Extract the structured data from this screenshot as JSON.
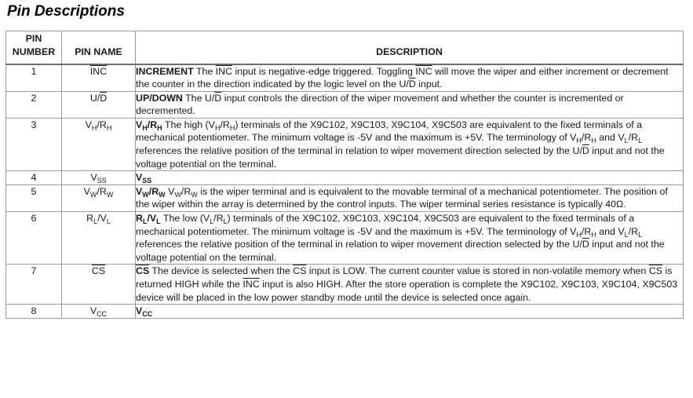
{
  "page": {
    "title": "Pin Descriptions"
  },
  "table": {
    "headers": {
      "pin_number_1": "PIN",
      "pin_number_2": "NUMBER",
      "pin_name": "PIN NAME",
      "description": "DESCRIPTION"
    },
    "rows": [
      {
        "number": "1",
        "name": [
          {
            "t": "INC",
            "o": true
          }
        ],
        "desc": [
          {
            "t": "INCREMENT",
            "b": true
          },
          {
            "t": " The "
          },
          {
            "t": "INC",
            "o": true
          },
          {
            "t": " input is negative-edge triggered. Toggling "
          },
          {
            "t": "INC",
            "o": true
          },
          {
            "t": " will move the wiper and either increment or decrement the counter in the direction indicated by the logic level on the U/"
          },
          {
            "t": "D",
            "o": true
          },
          {
            "t": " input."
          }
        ]
      },
      {
        "number": "2",
        "name": [
          {
            "t": "U/"
          },
          {
            "t": "D",
            "o": true
          }
        ],
        "desc": [
          {
            "t": "UP/DOWN",
            "b": true
          },
          {
            "t": " The U/"
          },
          {
            "t": "D",
            "o": true
          },
          {
            "t": " input controls the direction of the wiper movement and whether the counter is incremented or decremented."
          }
        ]
      },
      {
        "number": "3",
        "name": [
          {
            "t": "V"
          },
          {
            "t": "H",
            "s": true
          },
          {
            "t": "/R"
          },
          {
            "t": "H",
            "s": true
          }
        ],
        "desc": [
          {
            "t": "V",
            "b": true
          },
          {
            "t": "H",
            "s": true,
            "b": true
          },
          {
            "t": "/R",
            "b": true
          },
          {
            "t": "H",
            "s": true,
            "b": true
          },
          {
            "t": " The high (V"
          },
          {
            "t": "H",
            "s": true
          },
          {
            "t": "/R"
          },
          {
            "t": "H",
            "s": true
          },
          {
            "t": ") terminals of the X9C102, X9C103, X9C104, X9C503 are equivalent to the fixed terminals of a mechanical potentiometer. The minimum voltage is -5V and the maximum is +5V. The terminology of V"
          },
          {
            "t": "H",
            "s": true
          },
          {
            "t": "/R"
          },
          {
            "t": "H",
            "s": true
          },
          {
            "t": " and V"
          },
          {
            "t": "L",
            "s": true
          },
          {
            "t": "/R"
          },
          {
            "t": "L",
            "s": true
          },
          {
            "t": " references the relative position of the terminal in relation to wiper movement direction selected by the U/"
          },
          {
            "t": "D",
            "o": true
          },
          {
            "t": " input and not the voltage potential on the terminal."
          }
        ]
      },
      {
        "number": "4",
        "name": [
          {
            "t": "V"
          },
          {
            "t": "SS",
            "s": true
          }
        ],
        "desc": [
          {
            "t": "V",
            "b": true
          },
          {
            "t": "SS",
            "s": true,
            "b": true
          }
        ]
      },
      {
        "number": "5",
        "name": [
          {
            "t": "V"
          },
          {
            "t": "W",
            "s": true
          },
          {
            "t": "/R"
          },
          {
            "t": "W",
            "s": true
          }
        ],
        "desc": [
          {
            "t": "V",
            "b": true
          },
          {
            "t": "W",
            "s": true,
            "b": true
          },
          {
            "t": "/R",
            "b": true
          },
          {
            "t": "W",
            "s": true,
            "b": true
          },
          {
            "t": " V"
          },
          {
            "t": "W",
            "s": true
          },
          {
            "t": "/R"
          },
          {
            "t": "W",
            "s": true
          },
          {
            "t": " is the wiper terminal and is equivalent to the movable terminal of a mechanical potentiometer. The position of the wiper within the array is determined by the control inputs. The wiper terminal series resistance is typically 40Ω."
          }
        ]
      },
      {
        "number": "6",
        "name": [
          {
            "t": "R"
          },
          {
            "t": "L",
            "s": true
          },
          {
            "t": "/V"
          },
          {
            "t": "L",
            "s": true
          }
        ],
        "desc": [
          {
            "t": "R",
            "b": true
          },
          {
            "t": "L",
            "s": true,
            "b": true
          },
          {
            "t": "/V",
            "b": true
          },
          {
            "t": "L",
            "s": true,
            "b": true
          },
          {
            "t": " The low (V"
          },
          {
            "t": "L",
            "s": true
          },
          {
            "t": "/R"
          },
          {
            "t": "L",
            "s": true
          },
          {
            "t": ") terminals of the X9C102, X9C103, X9C104, X9C503 are equivalent to the fixed terminals of a mechanical potentiometer. The minimum voltage is -5V and the maximum is +5V. The terminology of V"
          },
          {
            "t": "H",
            "s": true
          },
          {
            "t": "/R"
          },
          {
            "t": "H",
            "s": true
          },
          {
            "t": " and V"
          },
          {
            "t": "L",
            "s": true
          },
          {
            "t": "/R"
          },
          {
            "t": "L",
            "s": true
          },
          {
            "t": " references the relative position of the terminal in relation to wiper movement direction selected by the U/"
          },
          {
            "t": "D",
            "o": true
          },
          {
            "t": " input and not the voltage potential on the terminal."
          }
        ]
      },
      {
        "number": "7",
        "name": [
          {
            "t": "CS",
            "o": true
          }
        ],
        "desc": [
          {
            "t": "CS",
            "b": true,
            "o": true
          },
          {
            "t": " The device is selected when the "
          },
          {
            "t": "CS",
            "o": true
          },
          {
            "t": " input is LOW. The current counter value is stored in non-volatile memory when "
          },
          {
            "t": "CS",
            "o": true
          },
          {
            "t": " is returned HIGH while the "
          },
          {
            "t": "INC",
            "o": true
          },
          {
            "t": " input is also HIGH. After the store operation is complete the X9C102, X9C103, X9C104, X9C503 device will be placed in the low power standby mode until the device is selected once again."
          }
        ]
      },
      {
        "number": "8",
        "name": [
          {
            "t": "V"
          },
          {
            "t": "CC",
            "s": true
          }
        ],
        "desc": [
          {
            "t": "V",
            "b": true
          },
          {
            "t": "CC",
            "s": true,
            "b": true
          }
        ]
      }
    ]
  }
}
